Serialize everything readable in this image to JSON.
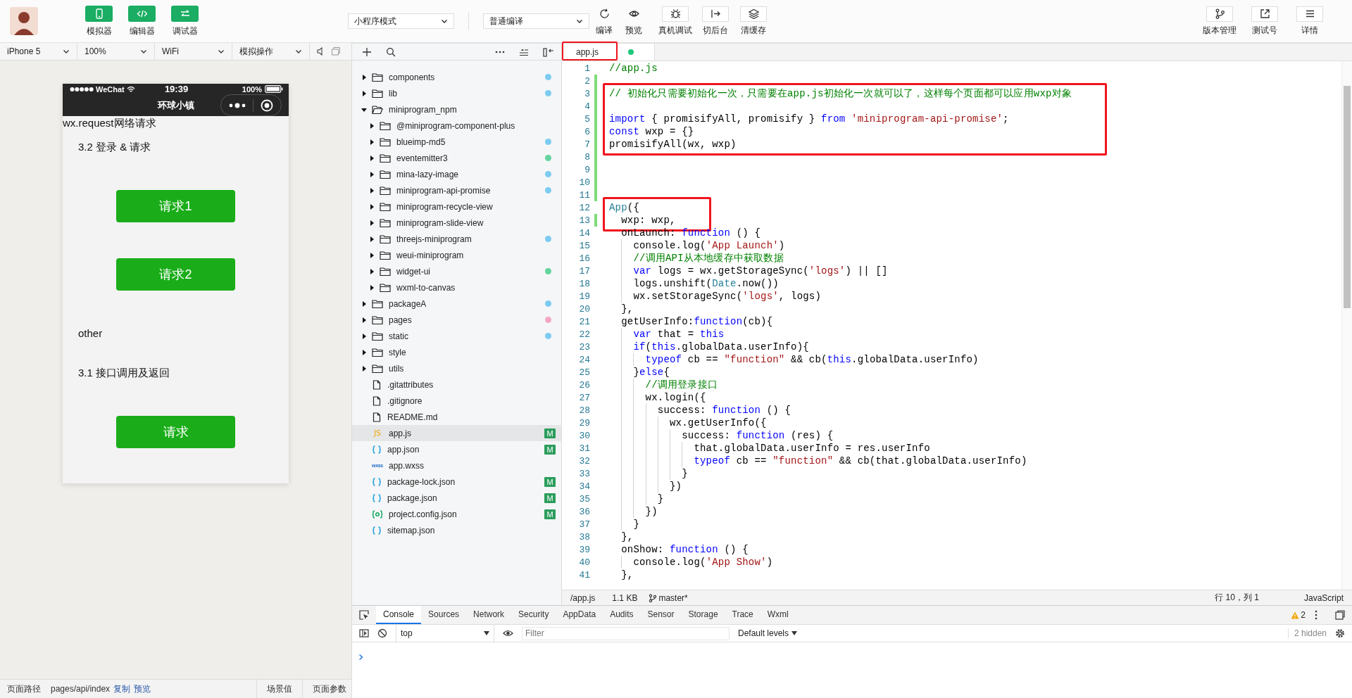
{
  "toolbar": {
    "view_toggles": [
      {
        "label": "模拟器",
        "kind": "phone",
        "on": true
      },
      {
        "label": "编辑器",
        "kind": "code",
        "on": true
      },
      {
        "label": "调试器",
        "kind": "swap",
        "on": true
      }
    ],
    "mode_select": "小程序模式",
    "compile_select": "普通编译",
    "compile_actions": [
      {
        "label": "编译",
        "kind": "refresh"
      },
      {
        "label": "预览",
        "kind": "eye"
      }
    ],
    "actions": [
      {
        "label": "真机调试",
        "kind": "bug"
      },
      {
        "label": "切后台",
        "kind": "exit"
      },
      {
        "label": "清缓存",
        "kind": "layers"
      }
    ],
    "right_actions": [
      {
        "label": "版本管理",
        "kind": "branch"
      },
      {
        "label": "测试号",
        "kind": "external"
      },
      {
        "label": "详情",
        "kind": "menu"
      }
    ]
  },
  "simulator": {
    "selects": [
      "iPhone 5",
      "100%",
      "WiFi",
      "模拟操作"
    ],
    "phone": {
      "carrier": "WeChat",
      "time": "19:39",
      "battery": "100%",
      "nav_title": "环球小镇",
      "content": [
        {
          "kind": "heading",
          "text": "wx.request网络请求"
        },
        {
          "kind": "text",
          "text": "3.2 登录 & 请求"
        },
        {
          "kind": "button",
          "text": "请求1"
        },
        {
          "kind": "button",
          "text": "请求2"
        },
        {
          "kind": "text",
          "text": "other"
        },
        {
          "kind": "text",
          "text": "3.1 接口调用及返回"
        },
        {
          "kind": "button",
          "text": "请求"
        }
      ]
    },
    "status_bar": {
      "path_label": "页面路径",
      "path": "pages/api/index",
      "links": [
        "复制",
        "预览"
      ],
      "scene": "场景值",
      "params": "页面参数"
    }
  },
  "explorer": {
    "items": [
      {
        "name": "components",
        "kind": "folder",
        "expanded": false,
        "selected": false,
        "color": "#7ccbf3"
      },
      {
        "name": "lib",
        "kind": "folder",
        "expanded": false,
        "selected": false,
        "color": "#7ccbf3"
      },
      {
        "name": "miniprogram_npm",
        "kind": "folder",
        "expanded": true,
        "selected": false,
        "children": [
          {
            "name": "@miniprogram-component-plus",
            "kind": "folder",
            "expanded": false,
            "selected": false
          },
          {
            "name": "blueimp-md5",
            "kind": "folder",
            "expanded": false,
            "selected": false,
            "color": "#7ccbf3"
          },
          {
            "name": "eventemitter3",
            "kind": "folder",
            "expanded": false,
            "selected": false,
            "color": "#63d49e"
          },
          {
            "name": "mina-lazy-image",
            "kind": "folder",
            "expanded": false,
            "selected": false,
            "color": "#7ccbf3"
          },
          {
            "name": "miniprogram-api-promise",
            "kind": "folder",
            "expanded": false,
            "selected": false,
            "color": "#7ccbf3"
          },
          {
            "name": "miniprogram-recycle-view",
            "kind": "folder",
            "expanded": false,
            "selected": false
          },
          {
            "name": "miniprogram-slide-view",
            "kind": "folder",
            "expanded": false,
            "selected": false
          },
          {
            "name": "threejs-miniprogram",
            "kind": "folder",
            "expanded": false,
            "selected": false,
            "color": "#7ccbf3"
          },
          {
            "name": "weui-miniprogram",
            "kind": "folder",
            "expanded": false,
            "selected": false
          },
          {
            "name": "widget-ui",
            "kind": "folder",
            "expanded": false,
            "selected": false,
            "color": "#63d49e"
          },
          {
            "name": "wxml-to-canvas",
            "kind": "folder",
            "expanded": false,
            "selected": false
          }
        ]
      },
      {
        "name": "packageA",
        "kind": "folder",
        "expanded": false,
        "selected": false,
        "color": "#7ccbf3"
      },
      {
        "name": "pages",
        "kind": "folder",
        "expanded": false,
        "selected": false,
        "color": "#f5a7c4"
      },
      {
        "name": "static",
        "kind": "folder",
        "expanded": false,
        "selected": false,
        "color": "#7ccbf3"
      },
      {
        "name": "style",
        "kind": "folder",
        "expanded": false,
        "selected": false
      },
      {
        "name": "utils",
        "kind": "folder",
        "expanded": false,
        "selected": false
      },
      {
        "name": ".gitattributes",
        "kind": "file",
        "selected": false
      },
      {
        "name": ".gitignore",
        "kind": "file",
        "selected": false
      },
      {
        "name": "README.md",
        "kind": "file",
        "selected": false
      },
      {
        "name": "app.js",
        "kind": "js",
        "icon_label": "JS",
        "selected": true,
        "badge": "M"
      },
      {
        "name": "app.json",
        "kind": "json",
        "selected": false,
        "badge": "M"
      },
      {
        "name": "app.wxss",
        "kind": "wxss",
        "icon_label": "wxss",
        "selected": false
      },
      {
        "name": "package-lock.json",
        "kind": "json",
        "selected": false,
        "badge": "M"
      },
      {
        "name": "package.json",
        "kind": "json",
        "selected": false,
        "badge": "M"
      },
      {
        "name": "project.config.json",
        "kind": "config",
        "selected": false,
        "badge": "M"
      },
      {
        "name": "sitemap.json",
        "kind": "json",
        "selected": false
      }
    ]
  },
  "editor": {
    "tabs": [
      {
        "label": "app.js",
        "selected": true,
        "unsaved": true,
        "boxed": true
      }
    ],
    "blocks": [
      {
        "boxed": false,
        "lines": [
          {
            "n": "1",
            "changed": false,
            "tokens": [
              {
                "kind": "c",
                "text": "//app.js"
              }
            ]
          },
          {
            "n": "2",
            "changed": true
          }
        ]
      },
      {
        "boxed": true,
        "lines": [
          {
            "n": "3",
            "changed": true,
            "tokens": [
              {
                "kind": "c",
                "text": "// 初始化只需要初始化一次，只需要在app.js初始化一次就可以了，这样每个页面都可以应用wxp对象"
              }
            ]
          },
          {
            "n": "4",
            "changed": true
          },
          {
            "n": "5",
            "changed": true,
            "tokens": [
              {
                "kind": "k",
                "text": "import"
              },
              {
                "kind": "p",
                "text": " { promisifyAll, promisify } "
              },
              {
                "kind": "k",
                "text": "from"
              },
              {
                "kind": "s",
                "text": " 'miniprogram-api-promise'"
              },
              {
                "kind": "p",
                "text": ";"
              }
            ]
          },
          {
            "n": "6",
            "changed": true,
            "tokens": [
              {
                "kind": "k",
                "text": "const"
              },
              {
                "kind": "p",
                "text": " wxp = {}"
              }
            ]
          },
          {
            "n": "7",
            "changed": true,
            "tokens": [
              {
                "kind": "p",
                "text": "promisifyAll(wx, wxp)"
              }
            ]
          }
        ]
      },
      {
        "boxed": false,
        "lines": [
          {
            "n": "8",
            "changed": true
          },
          {
            "n": "9",
            "changed": true
          },
          {
            "n": "10",
            "changed": true
          },
          {
            "n": "11",
            "changed": true
          }
        ]
      },
      {
        "boxed": true,
        "lines": [
          {
            "n": "12",
            "changed": false,
            "tokens": [
              {
                "kind": "t",
                "text": "App"
              },
              {
                "kind": "p",
                "text": "({"
              }
            ]
          },
          {
            "n": "13",
            "changed": true,
            "tokens": [
              {
                "kind": "p",
                "text": "  wxp: wxp,"
              }
            ]
          }
        ]
      },
      {
        "boxed": false,
        "lines": [
          {
            "n": "14",
            "changed": false,
            "tokens": [
              {
                "kind": "p",
                "text": "  onLaunch: "
              },
              {
                "kind": "k",
                "text": "function"
              },
              {
                "kind": "p",
                "text": " () {"
              }
            ]
          },
          {
            "n": "15",
            "changed": false,
            "tokens": [
              {
                "kind": "p",
                "text": "    console.log("
              },
              {
                "kind": "s",
                "text": "'App Launch'"
              },
              {
                "kind": "p",
                "text": ")"
              }
            ]
          },
          {
            "n": "16",
            "changed": false,
            "tokens": [
              {
                "kind": "c",
                "text": "    //调用API从本地缓存中获取数据"
              }
            ]
          },
          {
            "n": "17",
            "changed": false,
            "tokens": [
              {
                "kind": "k",
                "text": "    var"
              },
              {
                "kind": "p",
                "text": " logs = wx.getStorageSync("
              },
              {
                "kind": "s",
                "text": "'logs'"
              },
              {
                "kind": "p",
                "text": ") || []"
              }
            ]
          },
          {
            "n": "18",
            "changed": false,
            "tokens": [
              {
                "kind": "p",
                "text": "    logs.unshift("
              },
              {
                "kind": "t",
                "text": "Date"
              },
              {
                "kind": "p",
                "text": ".now())"
              }
            ]
          },
          {
            "n": "19",
            "changed": false,
            "tokens": [
              {
                "kind": "p",
                "text": "    wx.setStorageSync("
              },
              {
                "kind": "s",
                "text": "'logs'"
              },
              {
                "kind": "p",
                "text": ", logs)"
              }
            ]
          },
          {
            "n": "20",
            "changed": false,
            "tokens": [
              {
                "kind": "p",
                "text": "  },"
              }
            ]
          },
          {
            "n": "21",
            "changed": false,
            "tokens": [
              {
                "kind": "p",
                "text": "  getUserInfo:"
              },
              {
                "kind": "k",
                "text": "function"
              },
              {
                "kind": "p",
                "text": "(cb){"
              }
            ]
          },
          {
            "n": "22",
            "changed": false,
            "tokens": [
              {
                "kind": "k",
                "text": "    var"
              },
              {
                "kind": "p",
                "text": " that = "
              },
              {
                "kind": "k",
                "text": "this"
              }
            ]
          },
          {
            "n": "23",
            "changed": false,
            "tokens": [
              {
                "kind": "k",
                "text": "    if"
              },
              {
                "kind": "p",
                "text": "("
              },
              {
                "kind": "k",
                "text": "this"
              },
              {
                "kind": "p",
                "text": ".globalData.userInfo){"
              }
            ]
          },
          {
            "n": "24",
            "changed": false,
            "tokens": [
              {
                "kind": "k",
                "text": "      typeof"
              },
              {
                "kind": "p",
                "text": " cb == "
              },
              {
                "kind": "s",
                "text": "\"function\""
              },
              {
                "kind": "p",
                "text": " && cb("
              },
              {
                "kind": "k",
                "text": "this"
              },
              {
                "kind": "p",
                "text": ".globalData.userInfo)"
              }
            ]
          },
          {
            "n": "25",
            "changed": false,
            "tokens": [
              {
                "kind": "p",
                "text": "    }"
              },
              {
                "kind": "k",
                "text": "else"
              },
              {
                "kind": "p",
                "text": "{"
              }
            ]
          },
          {
            "n": "26",
            "changed": false,
            "tokens": [
              {
                "kind": "c",
                "text": "      //调用登录接口"
              }
            ]
          },
          {
            "n": "27",
            "changed": false,
            "tokens": [
              {
                "kind": "p",
                "text": "      wx.login({"
              }
            ]
          },
          {
            "n": "28",
            "changed": false,
            "tokens": [
              {
                "kind": "p",
                "text": "        success: "
              },
              {
                "kind": "k",
                "text": "function"
              },
              {
                "kind": "p",
                "text": " () {"
              }
            ]
          },
          {
            "n": "29",
            "changed": false,
            "tokens": [
              {
                "kind": "p",
                "text": "          wx.getUserInfo({"
              }
            ]
          },
          {
            "n": "30",
            "changed": false,
            "tokens": [
              {
                "kind": "p",
                "text": "            success: "
              },
              {
                "kind": "k",
                "text": "function"
              },
              {
                "kind": "p",
                "text": " (res) {"
              }
            ]
          },
          {
            "n": "31",
            "changed": false,
            "tokens": [
              {
                "kind": "p",
                "text": "              that.globalData.userInfo = res.userInfo"
              }
            ]
          },
          {
            "n": "32",
            "changed": false,
            "tokens": [
              {
                "kind": "k",
                "text": "              typeof"
              },
              {
                "kind": "p",
                "text": " cb == "
              },
              {
                "kind": "s",
                "text": "\"function\""
              },
              {
                "kind": "p",
                "text": " && cb(that.globalData.userInfo)"
              }
            ]
          },
          {
            "n": "33",
            "changed": false,
            "tokens": [
              {
                "kind": "p",
                "text": "            }"
              }
            ]
          },
          {
            "n": "34",
            "changed": false,
            "tokens": [
              {
                "kind": "p",
                "text": "          })"
              }
            ]
          },
          {
            "n": "35",
            "changed": false,
            "tokens": [
              {
                "kind": "p",
                "text": "        }"
              }
            ]
          },
          {
            "n": "36",
            "changed": false,
            "tokens": [
              {
                "kind": "p",
                "text": "      })"
              }
            ]
          },
          {
            "n": "37",
            "changed": false,
            "tokens": [
              {
                "kind": "p",
                "text": "    }"
              }
            ]
          },
          {
            "n": "38",
            "changed": false,
            "tokens": [
              {
                "kind": "p",
                "text": "  },"
              }
            ]
          },
          {
            "n": "39",
            "changed": false,
            "tokens": [
              {
                "kind": "p",
                "text": "  onShow: "
              },
              {
                "kind": "k",
                "text": "function"
              },
              {
                "kind": "p",
                "text": " () {"
              }
            ]
          },
          {
            "n": "40",
            "changed": false,
            "tokens": [
              {
                "kind": "p",
                "text": "    console.log("
              },
              {
                "kind": "s",
                "text": "'App Show'"
              },
              {
                "kind": "p",
                "text": ")"
              }
            ]
          },
          {
            "n": "41",
            "changed": false,
            "tokens": [
              {
                "kind": "p",
                "text": "  },"
              }
            ]
          }
        ]
      }
    ],
    "status_bar": {
      "path": "/app.js",
      "size": "1.1 KB",
      "branch": "master*",
      "position": "行 10，列 1",
      "language": "JavaScript"
    }
  },
  "devtools": {
    "tabs": [
      {
        "label": "Console",
        "selected": true
      },
      {
        "label": "Sources",
        "selected": false
      },
      {
        "label": "Network",
        "selected": false
      },
      {
        "label": "Security",
        "selected": false
      },
      {
        "label": "AppData",
        "selected": false
      },
      {
        "label": "Audits",
        "selected": false
      },
      {
        "label": "Sensor",
        "selected": false
      },
      {
        "label": "Storage",
        "selected": false
      },
      {
        "label": "Trace",
        "selected": false
      },
      {
        "label": "Wxml",
        "selected": false
      }
    ],
    "warnings": "2",
    "context": "top",
    "filter_placeholder": "Filter",
    "levels": "Default levels",
    "hidden": "2 hidden"
  }
}
